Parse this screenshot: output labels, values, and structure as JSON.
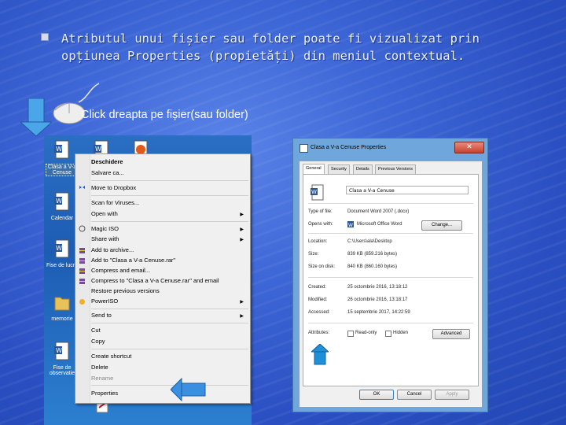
{
  "slide": {
    "bullet_text": "Atributul unui fișier sau folder poate fi vizualizat prin opțiunea Properties (propietăți) din meniul contextual.",
    "caption": "Click dreapta pe fișier(sau folder)"
  },
  "desktop": {
    "icons": [
      {
        "label": "Clasa a V-a Cenuse"
      },
      {
        "label": "Calendar"
      },
      {
        "label": "Fise de lucru"
      },
      {
        "label": "memorie"
      },
      {
        "label": "Fise de observatie"
      }
    ]
  },
  "context_menu": {
    "items": {
      "open": "Deschidere",
      "save_as": "Salvare ca...",
      "move_to_dropbox": "Move to Dropbox",
      "scan_for_viruses": "Scan for Viruses...",
      "open_with": "Open with",
      "magic_iso": "Magic ISO",
      "share_with": "Share with",
      "add_to_archive": "Add to archive...",
      "add_to_rar": "Add to \"Clasa a V-a Cenuse.rar\"",
      "compress_email": "Compress and email...",
      "compress_rar_email": "Compress to \"Clasa a V-a Cenuse.rar\" and email",
      "restore_versions": "Restore previous versions",
      "power_iso": "PowerISO",
      "send_to": "Send to",
      "cut": "Cut",
      "copy": "Copy",
      "create_shortcut": "Create shortcut",
      "delete": "Delete",
      "rename": "Rename",
      "properties": "Properties"
    }
  },
  "properties_dialog": {
    "title": "Clasa a V-a Cenuse Properties",
    "close_label": "✕",
    "tabs": {
      "general": "General",
      "security": "Security",
      "details": "Details",
      "previous": "Previous Versions"
    },
    "file_name": "Clasa a V-a Cenuse",
    "labels": {
      "type": "Type of file:",
      "opens_with": "Opens with:",
      "location": "Location:",
      "size": "Size:",
      "size_on_disk": "Size on disk:",
      "created": "Created:",
      "modified": "Modified:",
      "accessed": "Accessed:",
      "attributes": "Attributes:"
    },
    "values": {
      "type": "Document Word 2007 (.docx)",
      "opens_with": "Microsoft Office Word",
      "location": "C:\\Users\\ala\\Desktop",
      "size": "839 KB (859.216 bytes)",
      "size_on_disk": "840 KB (860.160 bytes)",
      "created": "25 octombrie 2016, 13:18:12",
      "modified": "26 octombrie 2016, 13:18:17",
      "accessed": "15 septembrie 2017, 14:22:59"
    },
    "buttons": {
      "change": "Change...",
      "advanced": "Advanced",
      "ok": "OK",
      "cancel": "Cancel",
      "apply": "Apply"
    },
    "attributes": {
      "read_only": "Read-only",
      "hidden": "Hidden"
    }
  }
}
